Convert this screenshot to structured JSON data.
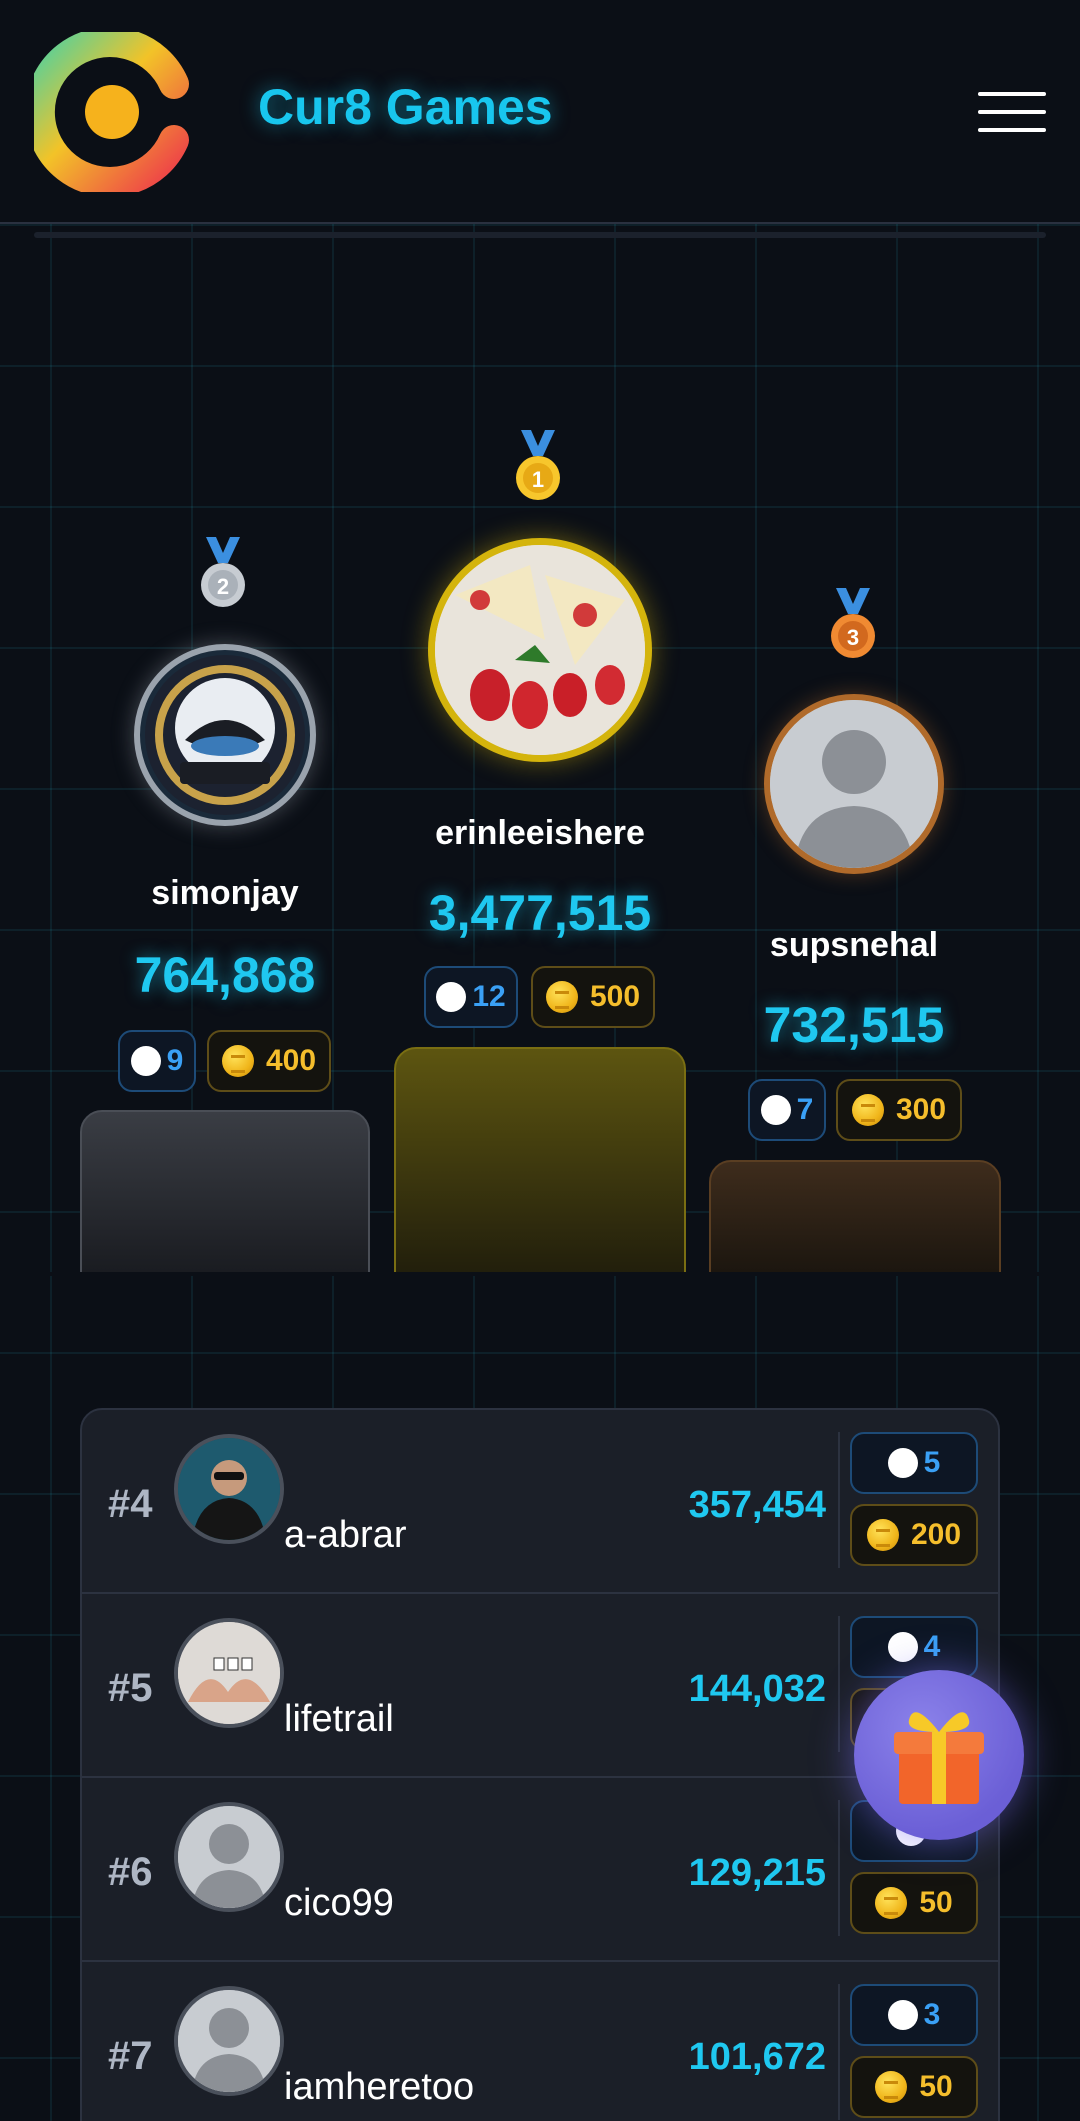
{
  "header": {
    "brand": "Cur8 Games",
    "logo_icon": "cur8-logo-icon",
    "menu_icon": "hamburger-menu-icon"
  },
  "podium": {
    "first": {
      "rank": "1",
      "name": "erinleeishere",
      "score": "3,477,515",
      "steem": "12",
      "coins": "500",
      "color": "#d4b40c"
    },
    "second": {
      "rank": "2",
      "name": "simonjay",
      "score": "764,868",
      "steem": "9",
      "coins": "400",
      "color": "#9aa3ad"
    },
    "third": {
      "rank": "3",
      "name": "supsnehal",
      "score": "732,515",
      "steem": "7",
      "coins": "300",
      "color": "#b06a2a"
    }
  },
  "list": [
    {
      "rank": "#4",
      "name": "a-abrar",
      "score": "357,454",
      "steem": "5",
      "coins": "200"
    },
    {
      "rank": "#5",
      "name": "lifetrail",
      "score": "144,032",
      "steem": "4",
      "coins": ""
    },
    {
      "rank": "#6",
      "name": "cico99",
      "score": "129,215",
      "steem": "",
      "coins": "50"
    },
    {
      "rank": "#7",
      "name": "iamheretoo",
      "score": "101,672",
      "steem": "3",
      "coins": "50"
    }
  ],
  "gift": {
    "icon": "gift-icon"
  },
  "colors": {
    "accent": "#1fc8f0",
    "gold": "#f5be2c",
    "steem": "#3aa0f5",
    "background": "#0b0f16"
  }
}
